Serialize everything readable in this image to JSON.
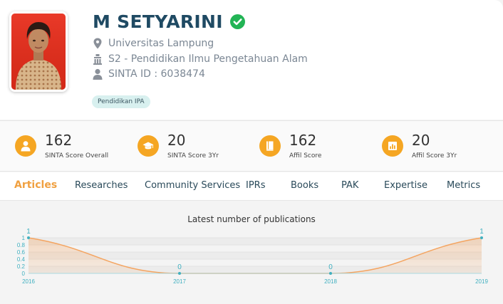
{
  "profile": {
    "name": "M SETYARINI",
    "affiliation": "Universitas Lampung",
    "program": "S2 - Pendidikan Ilmu Pengetahuan Alam",
    "sinta_id": "SINTA ID : 6038474",
    "tag": "Pendidikan IPA"
  },
  "stats": [
    {
      "value": "162",
      "label": "SINTA Score Overall",
      "icon": "person-icon"
    },
    {
      "value": "20",
      "label": "SINTA Score 3Yr",
      "icon": "graduation-cap-icon"
    },
    {
      "value": "162",
      "label": "Affil Score",
      "icon": "book-icon"
    },
    {
      "value": "20",
      "label": "Affil Score 3Yr",
      "icon": "bar-chart-icon"
    }
  ],
  "tabs": [
    {
      "label": "Articles",
      "active": true
    },
    {
      "label": "Researches"
    },
    {
      "label": "Community Services"
    },
    {
      "label": "IPRs"
    },
    {
      "label": "Books"
    },
    {
      "label": "PAK"
    },
    {
      "label": "Expertise"
    },
    {
      "label": "Metrics"
    }
  ],
  "colors": {
    "accent": "#f5a623",
    "name": "#1f4a63",
    "line": "#f4a460",
    "label": "#40b0c0"
  },
  "chart_data": {
    "type": "area",
    "title": "Latest number of publications",
    "x": [
      "2016",
      "2017",
      "2018",
      "2019"
    ],
    "values": [
      1,
      0,
      0,
      1
    ],
    "ylim": [
      0,
      1
    ],
    "yticks": [
      "0",
      "0.2",
      "0.4",
      "0.6",
      "0.8",
      "1"
    ],
    "data_labels": [
      "1",
      "0",
      "0",
      "1"
    ],
    "grid": true
  }
}
